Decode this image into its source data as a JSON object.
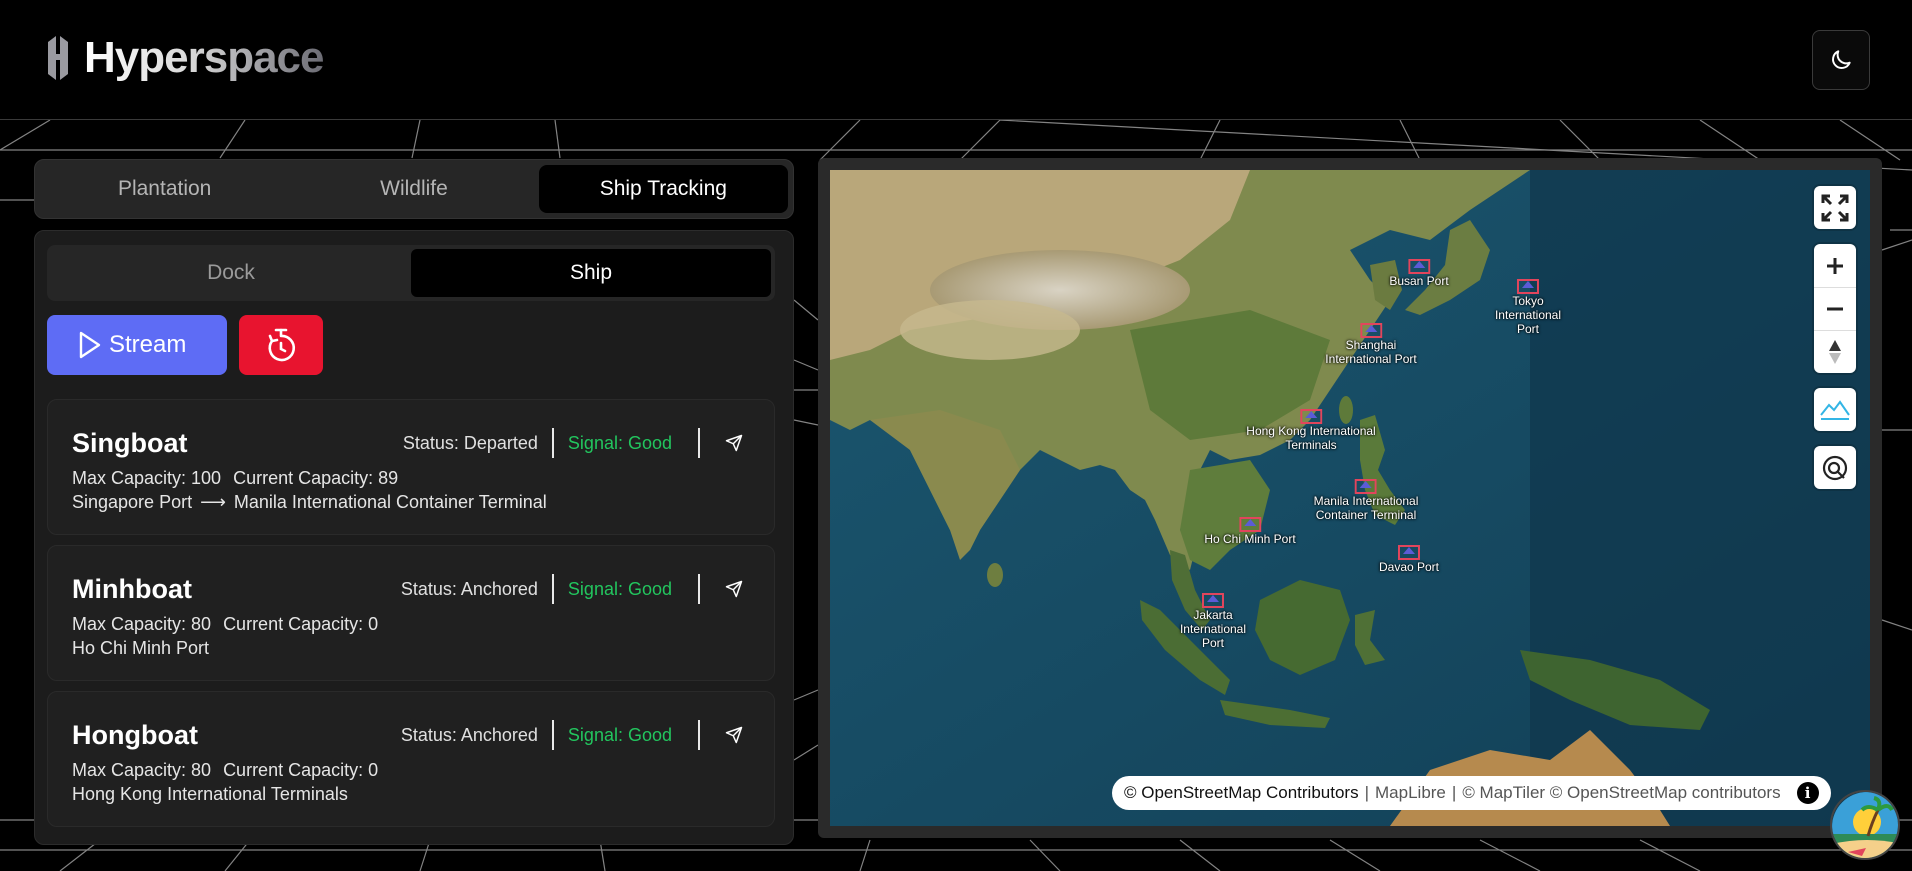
{
  "header": {
    "app_name": "Hyperspace",
    "theme_icon": "moon-icon"
  },
  "main_tabs": [
    {
      "label": "Plantation",
      "active": false
    },
    {
      "label": "Wildlife",
      "active": false
    },
    {
      "label": "Ship Tracking",
      "active": true
    }
  ],
  "sub_tabs": [
    {
      "label": "Dock",
      "active": false
    },
    {
      "label": "Ship",
      "active": true
    }
  ],
  "actions": {
    "stream_label": "Stream",
    "stream_color": "#5e6cf5",
    "history_icon": "timer-icon",
    "history_color": "#e8142f"
  },
  "ships": [
    {
      "name": "Singboat",
      "status": "Status: Departed",
      "signal": "Signal: Good",
      "max_capacity": "Max Capacity: 100",
      "current_capacity": "Current Capacity: 89",
      "origin": "Singapore Port",
      "arrow": "⟶",
      "destination": "Manila International Container Terminal"
    },
    {
      "name": "Minhboat",
      "status": "Status: Anchored",
      "signal": "Signal: Good",
      "max_capacity": "Max Capacity: 80",
      "current_capacity": "Current Capacity: 0",
      "origin": "Ho Chi Minh Port",
      "arrow": "",
      "destination": ""
    },
    {
      "name": "Hongboat",
      "status": "Status: Anchored",
      "signal": "Signal: Good",
      "max_capacity": "Max Capacity: 80",
      "current_capacity": "Current Capacity: 0",
      "origin": "Hong Kong International Terminals",
      "arrow": "",
      "destination": ""
    }
  ],
  "signal_color": "#22c55e",
  "map": {
    "ports": [
      {
        "label": "Busan Port"
      },
      {
        "label": "Tokyo\nInternational\nPort"
      },
      {
        "label": "Shanghai\nInternational Port"
      },
      {
        "label": "Hong Kong International\nTerminals"
      },
      {
        "label": "Manila International\nContainer Terminal"
      },
      {
        "label": "Ho Chi Minh Port"
      },
      {
        "label": "Davao Port"
      },
      {
        "label": "Jakarta\nInternational\nPort"
      }
    ],
    "attribution": {
      "osm": "© OpenStreetMap Contributors",
      "sep1": "|",
      "maplibre": "MapLibre",
      "sep2": "|",
      "maptiler": "© MapTiler © OpenStreetMap contributors",
      "info": "i"
    },
    "controls": [
      "fullscreen-icon",
      "zoom-in-icon",
      "zoom-out-icon",
      "compass-icon",
      "terrain-icon",
      "globe-icon"
    ]
  }
}
